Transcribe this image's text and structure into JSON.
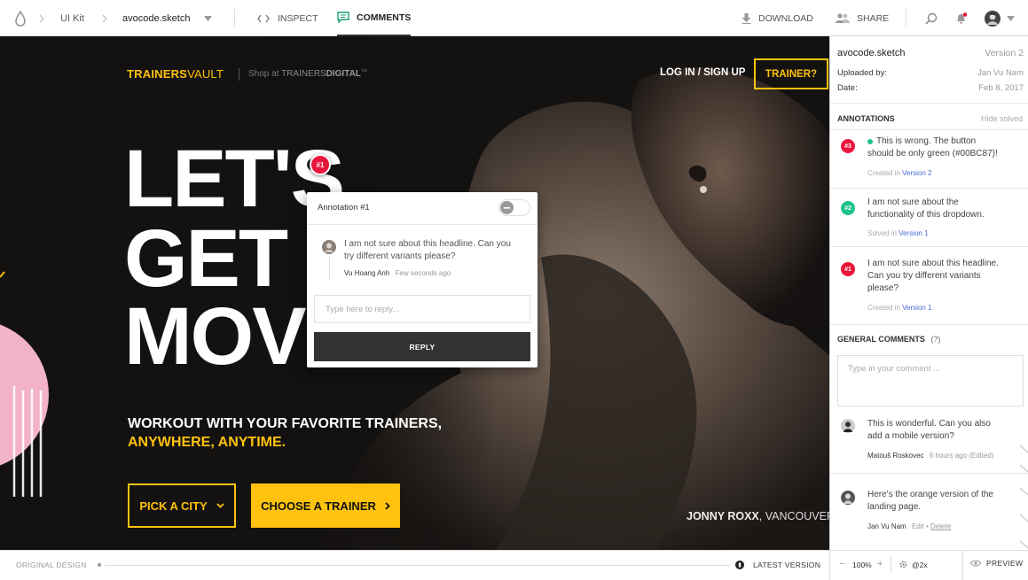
{
  "topbar": {
    "breadcrumb_project": "UI Kit",
    "breadcrumb_file": "avocode.sketch",
    "tab_inspect": "INSPECT",
    "tab_comments": "COMMENTS",
    "download_label": "DOWNLOAD",
    "share_label": "SHARE"
  },
  "design": {
    "brand_a": "TRAINERS",
    "brand_b": "VAULT",
    "shop_prefix": "Shop at",
    "shop_a": "TRAINERS",
    "shop_b": "DIGITAL",
    "shop_tm": "™",
    "login_label": "LOG IN / SIGN UP",
    "trainer_label": "TRAINER?",
    "headline_1": "LET'S",
    "headline_2": "GET",
    "headline_3": "MOVING.",
    "subhead_1": "WORKOUT WITH YOUR FAVORITE TRAINERS,",
    "subhead_2": "ANYWHERE, ANYTIME.",
    "pick_city_label": "PICK A CITY",
    "choose_trainer_label": "CHOOSE A TRAINER",
    "caption_name": "JONNY ROXX",
    "caption_city": ", VANCOUVER",
    "pin_label": "#1"
  },
  "popup": {
    "title": "Annotation #1",
    "comment_text": "I am not sure about this headline. Can you try different variants please?",
    "author": "Vu Hoang Anh",
    "time": "Few seconds ago",
    "reply_placeholder": "Type here to reply...",
    "reply_button": "REPLY"
  },
  "sidebar": {
    "file_name": "avocode.sketch",
    "version": "Version 2",
    "uploaded_label": "Uploaded by:",
    "uploaded_value": "Jan Vu Nam",
    "date_label": "Date:",
    "date_value": "Feb 8, 2017",
    "annotations_header": "ANNOTATIONS",
    "hide_solved": "Hide solved",
    "annotations": [
      {
        "badge": "#3",
        "color": "#e8173c",
        "line1": "This is wrong. The button",
        "line2": "should be only green (#00BC87)!",
        "line3": "",
        "meta_prefix": "Created in",
        "meta_version": "Version 2"
      },
      {
        "badge": "#2",
        "color": "#1ec38b",
        "line1": "I am not sure about the",
        "line2": "functionality of this dropdown.",
        "line3": "",
        "meta_prefix": "Solved in",
        "meta_version": "Version 1"
      },
      {
        "badge": "#1",
        "color": "#e8173c",
        "line1": "I am not sure about this headline.",
        "line2": "Can you try different variants",
        "line3": "please?",
        "meta_prefix": "Created in",
        "meta_version": "Version 1"
      }
    ],
    "general_header": "GENERAL COMMENTS",
    "help_mark": "(?)",
    "comment_placeholder": "Type in your comment ...",
    "comments": [
      {
        "line1": "This is wonderful. Can you also",
        "line2": "add a mobile version?",
        "author": "Matouš Roskovec",
        "time": "6 hours ago",
        "suffix": "(Edited)"
      },
      {
        "line1": "Here's the orange version of the",
        "line2": "landing page.",
        "author": "Jan Vu Nam",
        "edit": "Edit",
        "sep": "•",
        "delete": "Delete"
      }
    ]
  },
  "bottombar": {
    "original_label": "ORIGINAL DESIGN",
    "latest_label": "LATEST VERSION",
    "zoom_minus": "−",
    "zoom_value": "100%",
    "zoom_plus": "+",
    "scale_value": "@2x",
    "preview_label": "PREVIEW"
  },
  "colors": {
    "accent_yellow": "#ffc20e",
    "annotation_red": "#e8173c",
    "solved_green": "#1ec38b",
    "comments_tab_green": "#18a06c"
  }
}
